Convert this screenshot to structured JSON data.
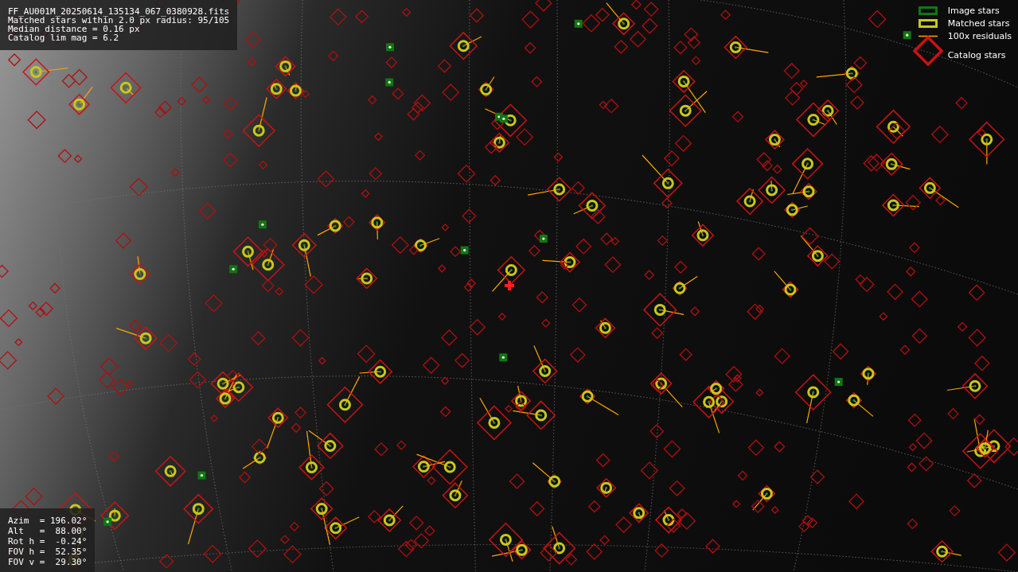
{
  "info_panel": {
    "lines": [
      "FF_AU001M_20250614_135134_067_0380928.fits",
      "Matched stars within 2.0 px radius: 95/105",
      "Median distance = 0.16 px",
      "Catalog lim mag = 6.2"
    ]
  },
  "legend": [
    {
      "kind": "image",
      "label": "Image stars",
      "color": "#117711"
    },
    {
      "kind": "matched",
      "label": "Matched stars",
      "color": "#c8c81a"
    },
    {
      "kind": "residual",
      "label": "100x residuals",
      "color": "#ffa500"
    },
    {
      "kind": "catalog",
      "label": "Catalog stars",
      "color": "#cc1111"
    }
  ],
  "pointing_panel": {
    "lines": [
      "Azim  = 196.02°",
      "Alt   =  88.00°",
      "Rot h =  -0.24°",
      "FOV h =  52.35°",
      "FOV v =  29.30°"
    ]
  }
}
